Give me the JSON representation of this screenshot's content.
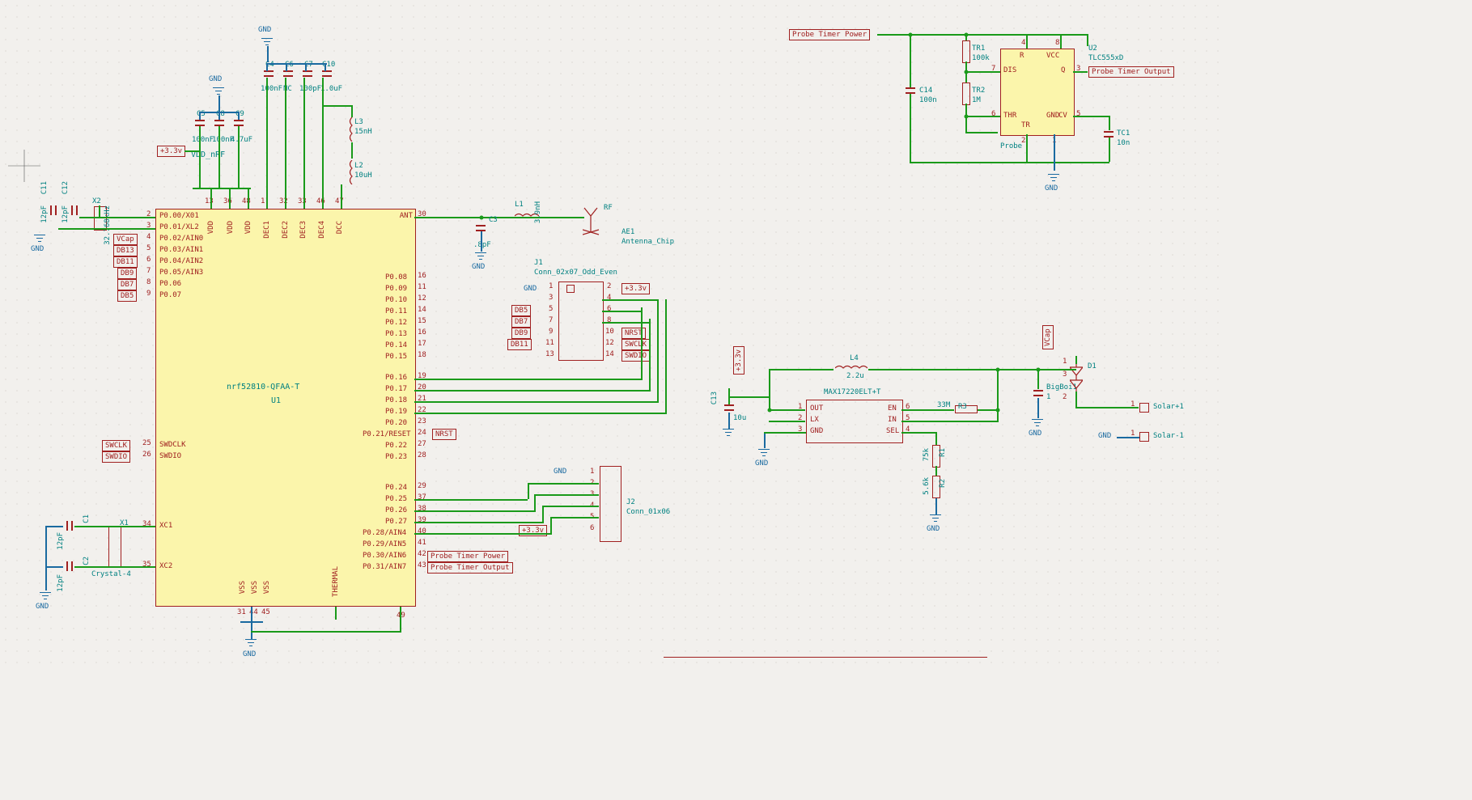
{
  "main_ic": {
    "ref": "U1",
    "value": "nrf52810-QFAA-T",
    "left_pins": [
      {
        "num": "2",
        "name": "P0.00/X01"
      },
      {
        "num": "3",
        "name": "P0.01/XL2"
      },
      {
        "num": "4",
        "name": "P0.02/AIN0"
      },
      {
        "num": "5",
        "name": "P0.03/AIN1"
      },
      {
        "num": "6",
        "name": "P0.04/AIN2"
      },
      {
        "num": "7",
        "name": "P0.05/AIN3"
      },
      {
        "num": "8",
        "name": "P0.06"
      },
      {
        "num": "9",
        "name": "P0.07"
      }
    ],
    "left_pins2": [
      {
        "num": "25",
        "name": "SWDCLK"
      },
      {
        "num": "26",
        "name": "SWDIO"
      }
    ],
    "left_pins3": [
      {
        "num": "34",
        "name": "XC1"
      },
      {
        "num": "35",
        "name": "XC2"
      }
    ],
    "top_pins": [
      {
        "num": "13",
        "name": "VDD"
      },
      {
        "num": "36",
        "name": "VDD"
      },
      {
        "num": "48",
        "name": "VDD"
      },
      {
        "num": "1",
        "name": "DEC1"
      },
      {
        "num": "32",
        "name": "DEC2"
      },
      {
        "num": "33",
        "name": "DEC3"
      },
      {
        "num": "46",
        "name": "DEC4"
      },
      {
        "num": "47",
        "name": "DCC"
      }
    ],
    "bot_pins": [
      {
        "num": "31",
        "name": "VSS"
      },
      {
        "num": "44",
        "name": "VSS"
      },
      {
        "num": "45",
        "name": "VSS"
      },
      {
        "num": "49",
        "name": "THERMAL"
      }
    ],
    "right_pins": [
      {
        "num": "30",
        "name": "ANT"
      },
      {
        "num": "16",
        "name": "P0.08"
      },
      {
        "num": "11",
        "name": "P0.09"
      },
      {
        "num": "12",
        "name": "P0.10"
      },
      {
        "num": "14",
        "name": "P0.11"
      },
      {
        "num": "15",
        "name": "P0.12"
      },
      {
        "num": "16",
        "name": "P0.13"
      },
      {
        "num": "17",
        "name": "P0.14"
      },
      {
        "num": "18",
        "name": "P0.15"
      },
      {
        "num": "19",
        "name": "P0.16"
      },
      {
        "num": "20",
        "name": "P0.17"
      },
      {
        "num": "21",
        "name": "P0.18"
      },
      {
        "num": "22",
        "name": "P0.19"
      },
      {
        "num": "23",
        "name": "P0.20"
      },
      {
        "num": "24",
        "name": "P0.21/RESET"
      },
      {
        "num": "27",
        "name": "P0.22"
      },
      {
        "num": "28",
        "name": "P0.23"
      },
      {
        "num": "29",
        "name": "P0.24"
      },
      {
        "num": "37",
        "name": "P0.25"
      },
      {
        "num": "38",
        "name": "P0.26"
      },
      {
        "num": "39",
        "name": "P0.27"
      },
      {
        "num": "40",
        "name": "P0.28/AIN4"
      },
      {
        "num": "41",
        "name": "P0.29/AIN5"
      },
      {
        "num": "42",
        "name": "P0.30/AIN6"
      },
      {
        "num": "43",
        "name": "P0.31/AIN7"
      }
    ]
  },
  "timer": {
    "ref": "U2",
    "value": "TLC555xD",
    "pins_left": [
      {
        "num": "7",
        "name": "DIS"
      },
      {
        "num": "6",
        "name": "THR"
      },
      {
        "num": "2",
        "name": "TR"
      }
    ],
    "pins_right": [
      {
        "num": "3",
        "name": "Q"
      },
      {
        "num": "5",
        "name": "CV"
      }
    ],
    "vcc": {
      "num": "8",
      "name": "VCC"
    },
    "gnd": {
      "num": "1",
      "name": "GND"
    },
    "r": {
      "num": "4",
      "name": "R"
    }
  },
  "boost": {
    "value": "MAX17220ELT+T",
    "pins_left": [
      {
        "num": "1",
        "name": "OUT"
      },
      {
        "num": "2",
        "name": "LX"
      },
      {
        "num": "3",
        "name": "GND"
      }
    ],
    "pins_right": [
      {
        "num": "6",
        "name": "EN"
      },
      {
        "num": "5",
        "name": "IN"
      },
      {
        "num": "4",
        "name": "SEL"
      }
    ]
  },
  "caps": {
    "C1": "12pF",
    "C2": "12pF",
    "C3": ".8pF",
    "C4": "100nF",
    "C5": "100nF",
    "C6": "100nF",
    "C7": "100pF",
    "C8": "NC",
    "C9": "4.7uF",
    "C10": "1.0uF",
    "C11": "12pF",
    "C12": "12pF",
    "C13": "10u",
    "C14": "100n",
    "TC1": "10n",
    "BigBoi1": "1"
  },
  "inductors": {
    "L1": "3.9nH",
    "L2": "10uH",
    "L3": "15nH",
    "L4": "2.2u"
  },
  "res": {
    "TR1": "100k",
    "TR2": "1M",
    "R1": "75k",
    "R2": "5.6k",
    "R3": "33M"
  },
  "crystals": {
    "X1": "Crystal-4",
    "X2": "32.768kHz"
  },
  "conn": {
    "J1": "Conn_02x07_Odd_Even",
    "J2": "Conn_01x06"
  },
  "ant": {
    "ref": "AE1",
    "value": "Antenna_Chip"
  },
  "diode": "D1",
  "solar": {
    "p": "Solar+1",
    "n": "Solar-1"
  },
  "labels": {
    "vcap": "VCap",
    "db13": "DB13",
    "db11": "DB11",
    "db9": "DB9",
    "db7": "DB7",
    "db5": "DB5",
    "swclk": "SWCLK",
    "swdio": "SWDIO",
    "nrst": "NRST",
    "ptp": "Probe Timer Power",
    "pto": "Probe Timer Output",
    "probe": "Probe",
    "rf": "RF",
    "vdd_nrf": "VDD_nRF"
  },
  "pwr": {
    "v33": "+3.3v",
    "gnd": "GND"
  }
}
